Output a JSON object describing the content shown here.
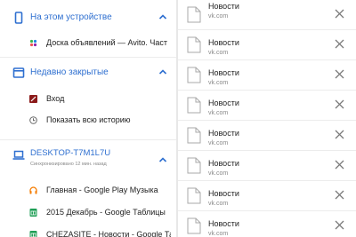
{
  "sections": [
    {
      "title": "На этом устройстве",
      "icon": "phone-icon",
      "items": [
        {
          "label": "Доска объявлений — Avito. Част",
          "icon": "avito-icon"
        }
      ]
    },
    {
      "title": "Недавно закрытые",
      "icon": "window-icon",
      "items": [
        {
          "label": "Вход",
          "icon": "login-icon"
        },
        {
          "label": "Показать всю историю",
          "icon": "clock-icon"
        }
      ]
    },
    {
      "title": "DESKTOP-T7M1L7U",
      "subtitle": "Синхронизировано 12 мин. назад",
      "icon": "laptop-icon",
      "items": [
        {
          "label": "Главная - Google Play Музыка",
          "icon": "headphones-icon"
        },
        {
          "label": "2015 Декабрь - Google Таблицы",
          "icon": "sheets-icon"
        },
        {
          "label": "CHEZASITE - Новости - Google Та",
          "icon": "sheets-icon"
        }
      ]
    }
  ],
  "tabs": [
    {
      "title": "Новости",
      "url": "vk.com"
    },
    {
      "title": "Новости",
      "url": "vk.com"
    },
    {
      "title": "Новости",
      "url": "vk.com"
    },
    {
      "title": "Новости",
      "url": "vk.com"
    },
    {
      "title": "Новости",
      "url": "vk.com"
    },
    {
      "title": "Новости",
      "url": "vk.com"
    },
    {
      "title": "Новости",
      "url": "vk.com"
    },
    {
      "title": "Новости",
      "url": "vk.com"
    }
  ],
  "colors": {
    "accent": "#2e6fd0",
    "muted": "#888888"
  }
}
